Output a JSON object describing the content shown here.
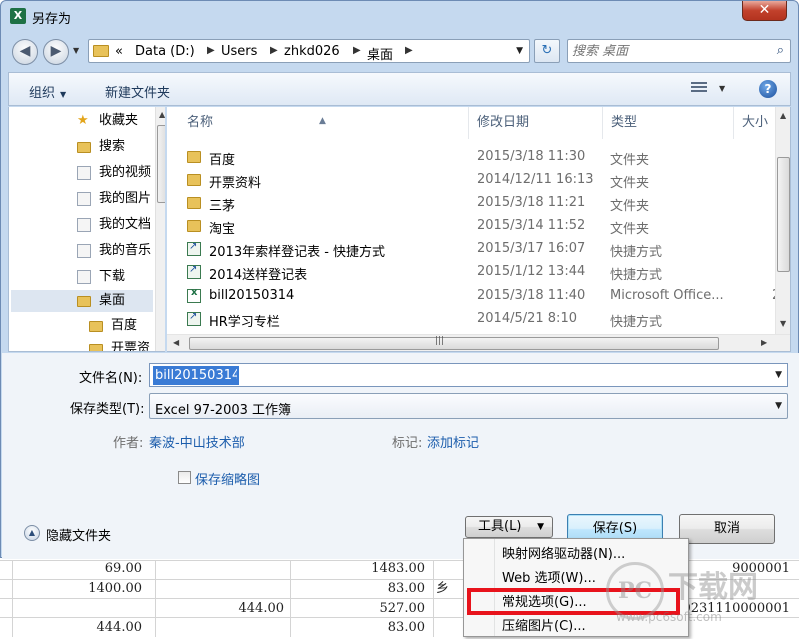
{
  "dialog": {
    "title": "另存为",
    "close_symbol": "✕"
  },
  "address": {
    "overflow": "«",
    "segments": [
      "Data (D:)",
      "Users",
      "zhkd026",
      "桌面"
    ]
  },
  "search": {
    "placeholder": "搜索 桌面"
  },
  "toolbar": {
    "organize_label": "组织",
    "new_folder_label": "新建文件夹",
    "help_symbol": "?"
  },
  "nav": {
    "items": [
      {
        "label": "收藏夹",
        "icon": "star-icon"
      },
      {
        "label": "搜索",
        "icon": "search-folder-icon"
      },
      {
        "label": "我的视频",
        "icon": "videos-icon"
      },
      {
        "label": "我的图片",
        "icon": "pictures-icon"
      },
      {
        "label": "我的文档",
        "icon": "documents-icon"
      },
      {
        "label": "我的音乐",
        "icon": "music-icon"
      },
      {
        "label": "下载",
        "icon": "downloads-icon"
      },
      {
        "label": "桌面",
        "icon": "desktop-icon"
      },
      {
        "label": "百度",
        "icon": "folder-icon"
      },
      {
        "label": "开票资",
        "icon": "folder-icon"
      }
    ]
  },
  "columns": {
    "name": "名称",
    "date": "修改日期",
    "type": "类型",
    "size": "大小"
  },
  "files": [
    {
      "name": "百度",
      "date": "2015/3/18 11:30",
      "type": "文件夹",
      "kind": "folder"
    },
    {
      "name": "开票资料",
      "date": "2014/12/11 16:13",
      "type": "文件夹",
      "kind": "folder"
    },
    {
      "name": "三茅",
      "date": "2015/3/18 11:21",
      "type": "文件夹",
      "kind": "folder"
    },
    {
      "name": "淘宝",
      "date": "2015/3/14 11:52",
      "type": "文件夹",
      "kind": "folder"
    },
    {
      "name": "2013年索样登记表 - 快捷方式",
      "date": "2015/3/17 16:07",
      "type": "快捷方式",
      "kind": "shortcut"
    },
    {
      "name": "2014送样登记表",
      "date": "2015/1/12 13:44",
      "type": "快捷方式",
      "kind": "shortcut"
    },
    {
      "name": "bill20150314",
      "date": "2015/3/18 11:40",
      "type": "Microsoft Office...",
      "kind": "excel",
      "size": "2"
    },
    {
      "name": "HR学习专栏",
      "date": "2014/5/21 8:10",
      "type": "快捷方式",
      "kind": "shortcut"
    }
  ],
  "form": {
    "filename_label": "文件名(N):",
    "filename_value": "bill20150314",
    "filetype_label": "保存类型(T):",
    "filetype_value": "Excel 97-2003 工作簿",
    "author_label": "作者:",
    "author_value": "秦波-中山技术部",
    "tags_label": "标记:",
    "tags_value": "添加标记",
    "thumbnail_label": "保存缩略图",
    "hide_folders_label": "隐藏文件夹"
  },
  "buttons": {
    "tools": "工具(L)",
    "save": "保存(S)",
    "cancel": "取消"
  },
  "tools_menu": [
    "映射网络驱动器(N)...",
    "Web 选项(W)...",
    "常规选项(G)...",
    "压缩图片(C)..."
  ],
  "sheet": {
    "cells": [
      "69.00",
      "1483.00",
      "1400.00",
      "83.00",
      "444.00",
      "527.00",
      "444.00",
      "83.00",
      "乡",
      "9000001",
      "0231110000001"
    ]
  },
  "watermark": {
    "circle": "PC",
    "text": "下载网",
    "url": "www.pc6soft.com"
  },
  "colors": {
    "accent": "#3a7bd5",
    "highlight_border": "#e8131c",
    "link": "#1c5dac",
    "frame": "#c5d9ef"
  }
}
